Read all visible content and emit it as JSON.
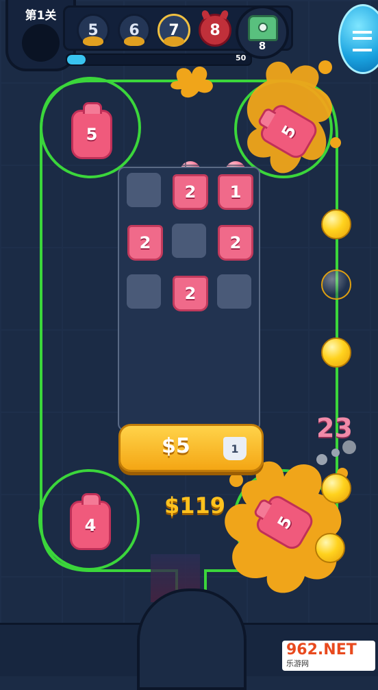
{
  "level": {
    "title": "第1关"
  },
  "stages": [
    {
      "label": "5",
      "state": "done"
    },
    {
      "label": "6",
      "state": "done"
    },
    {
      "label": "7",
      "state": "current"
    },
    {
      "label": "8",
      "state": "boss"
    }
  ],
  "chest": {
    "count": "8",
    "icon": "chest-icon"
  },
  "menu": {
    "icon": "menu-icon"
  },
  "progress": {
    "label": "50",
    "fraction": 0.1
  },
  "machines": [
    {
      "value": "5",
      "slot": "top-left"
    },
    {
      "value": "5",
      "slot": "top-right"
    },
    {
      "value": "4",
      "slot": "bottom-left"
    },
    {
      "value": "5",
      "slot": "bottom-right"
    }
  ],
  "grid": {
    "rows": [
      [
        "",
        "2",
        "1"
      ],
      [
        "2",
        "",
        "2"
      ],
      [
        "",
        "2",
        ""
      ]
    ]
  },
  "buy_button": {
    "price": "$5",
    "item_level": "1"
  },
  "money": "$119",
  "float_value": "23",
  "colors": {
    "track": "#3bd63b",
    "ball": "#ffd21e",
    "bottle": "#f05a7c",
    "button": "#f4a614"
  },
  "watermark": {
    "logo": "962.NET",
    "sub": "乐游网"
  }
}
